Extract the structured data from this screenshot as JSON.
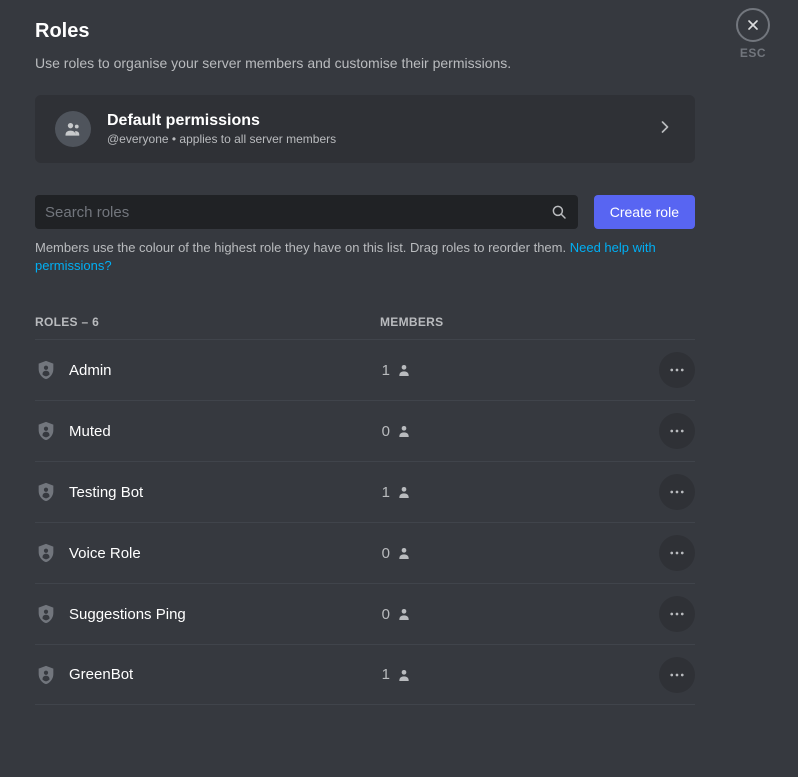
{
  "close": {
    "esc": "ESC"
  },
  "header": {
    "title": "Roles",
    "subtitle": "Use roles to organise your server members and customise their permissions."
  },
  "default_perms": {
    "title": "Default permissions",
    "subtitle": "@everyone • applies to all server members"
  },
  "search": {
    "placeholder": "Search roles"
  },
  "create_button": "Create role",
  "hint": {
    "text": "Members use the colour of the highest role they have on this list. Drag roles to reorder them. ",
    "link": "Need help with permissions?"
  },
  "table": {
    "roles_header": "ROLES – 6",
    "members_header": "MEMBERS",
    "rows": [
      {
        "name": "Admin",
        "members": "1"
      },
      {
        "name": "Muted",
        "members": "0"
      },
      {
        "name": "Testing Bot",
        "members": "1"
      },
      {
        "name": "Voice Role",
        "members": "0"
      },
      {
        "name": "Suggestions Ping",
        "members": "0"
      },
      {
        "name": "GreenBot",
        "members": "1"
      }
    ]
  }
}
